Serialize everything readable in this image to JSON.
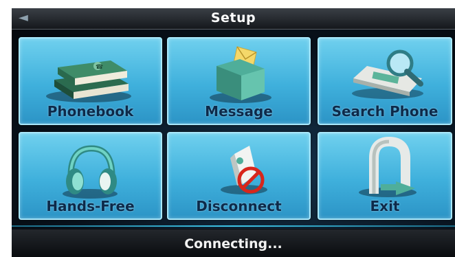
{
  "header": {
    "title": "Setup",
    "back_icon": "back-arrow-icon"
  },
  "tiles": [
    {
      "label": "Phonebook",
      "icon": "phonebook-icon"
    },
    {
      "label": "Message",
      "icon": "message-folder-icon"
    },
    {
      "label": "Search Phone",
      "icon": "search-phone-icon"
    },
    {
      "label": "Hands-Free",
      "icon": "headphones-icon"
    },
    {
      "label": "Disconnect",
      "icon": "disconnect-icon"
    },
    {
      "label": "Exit",
      "icon": "exit-icon"
    }
  ],
  "status": {
    "text": "Connecting..."
  },
  "colors": {
    "tile": "#3fb0dc",
    "tile_border": "#a9e8fb",
    "label": "#0d2a4a",
    "background": "#0a0d12"
  }
}
